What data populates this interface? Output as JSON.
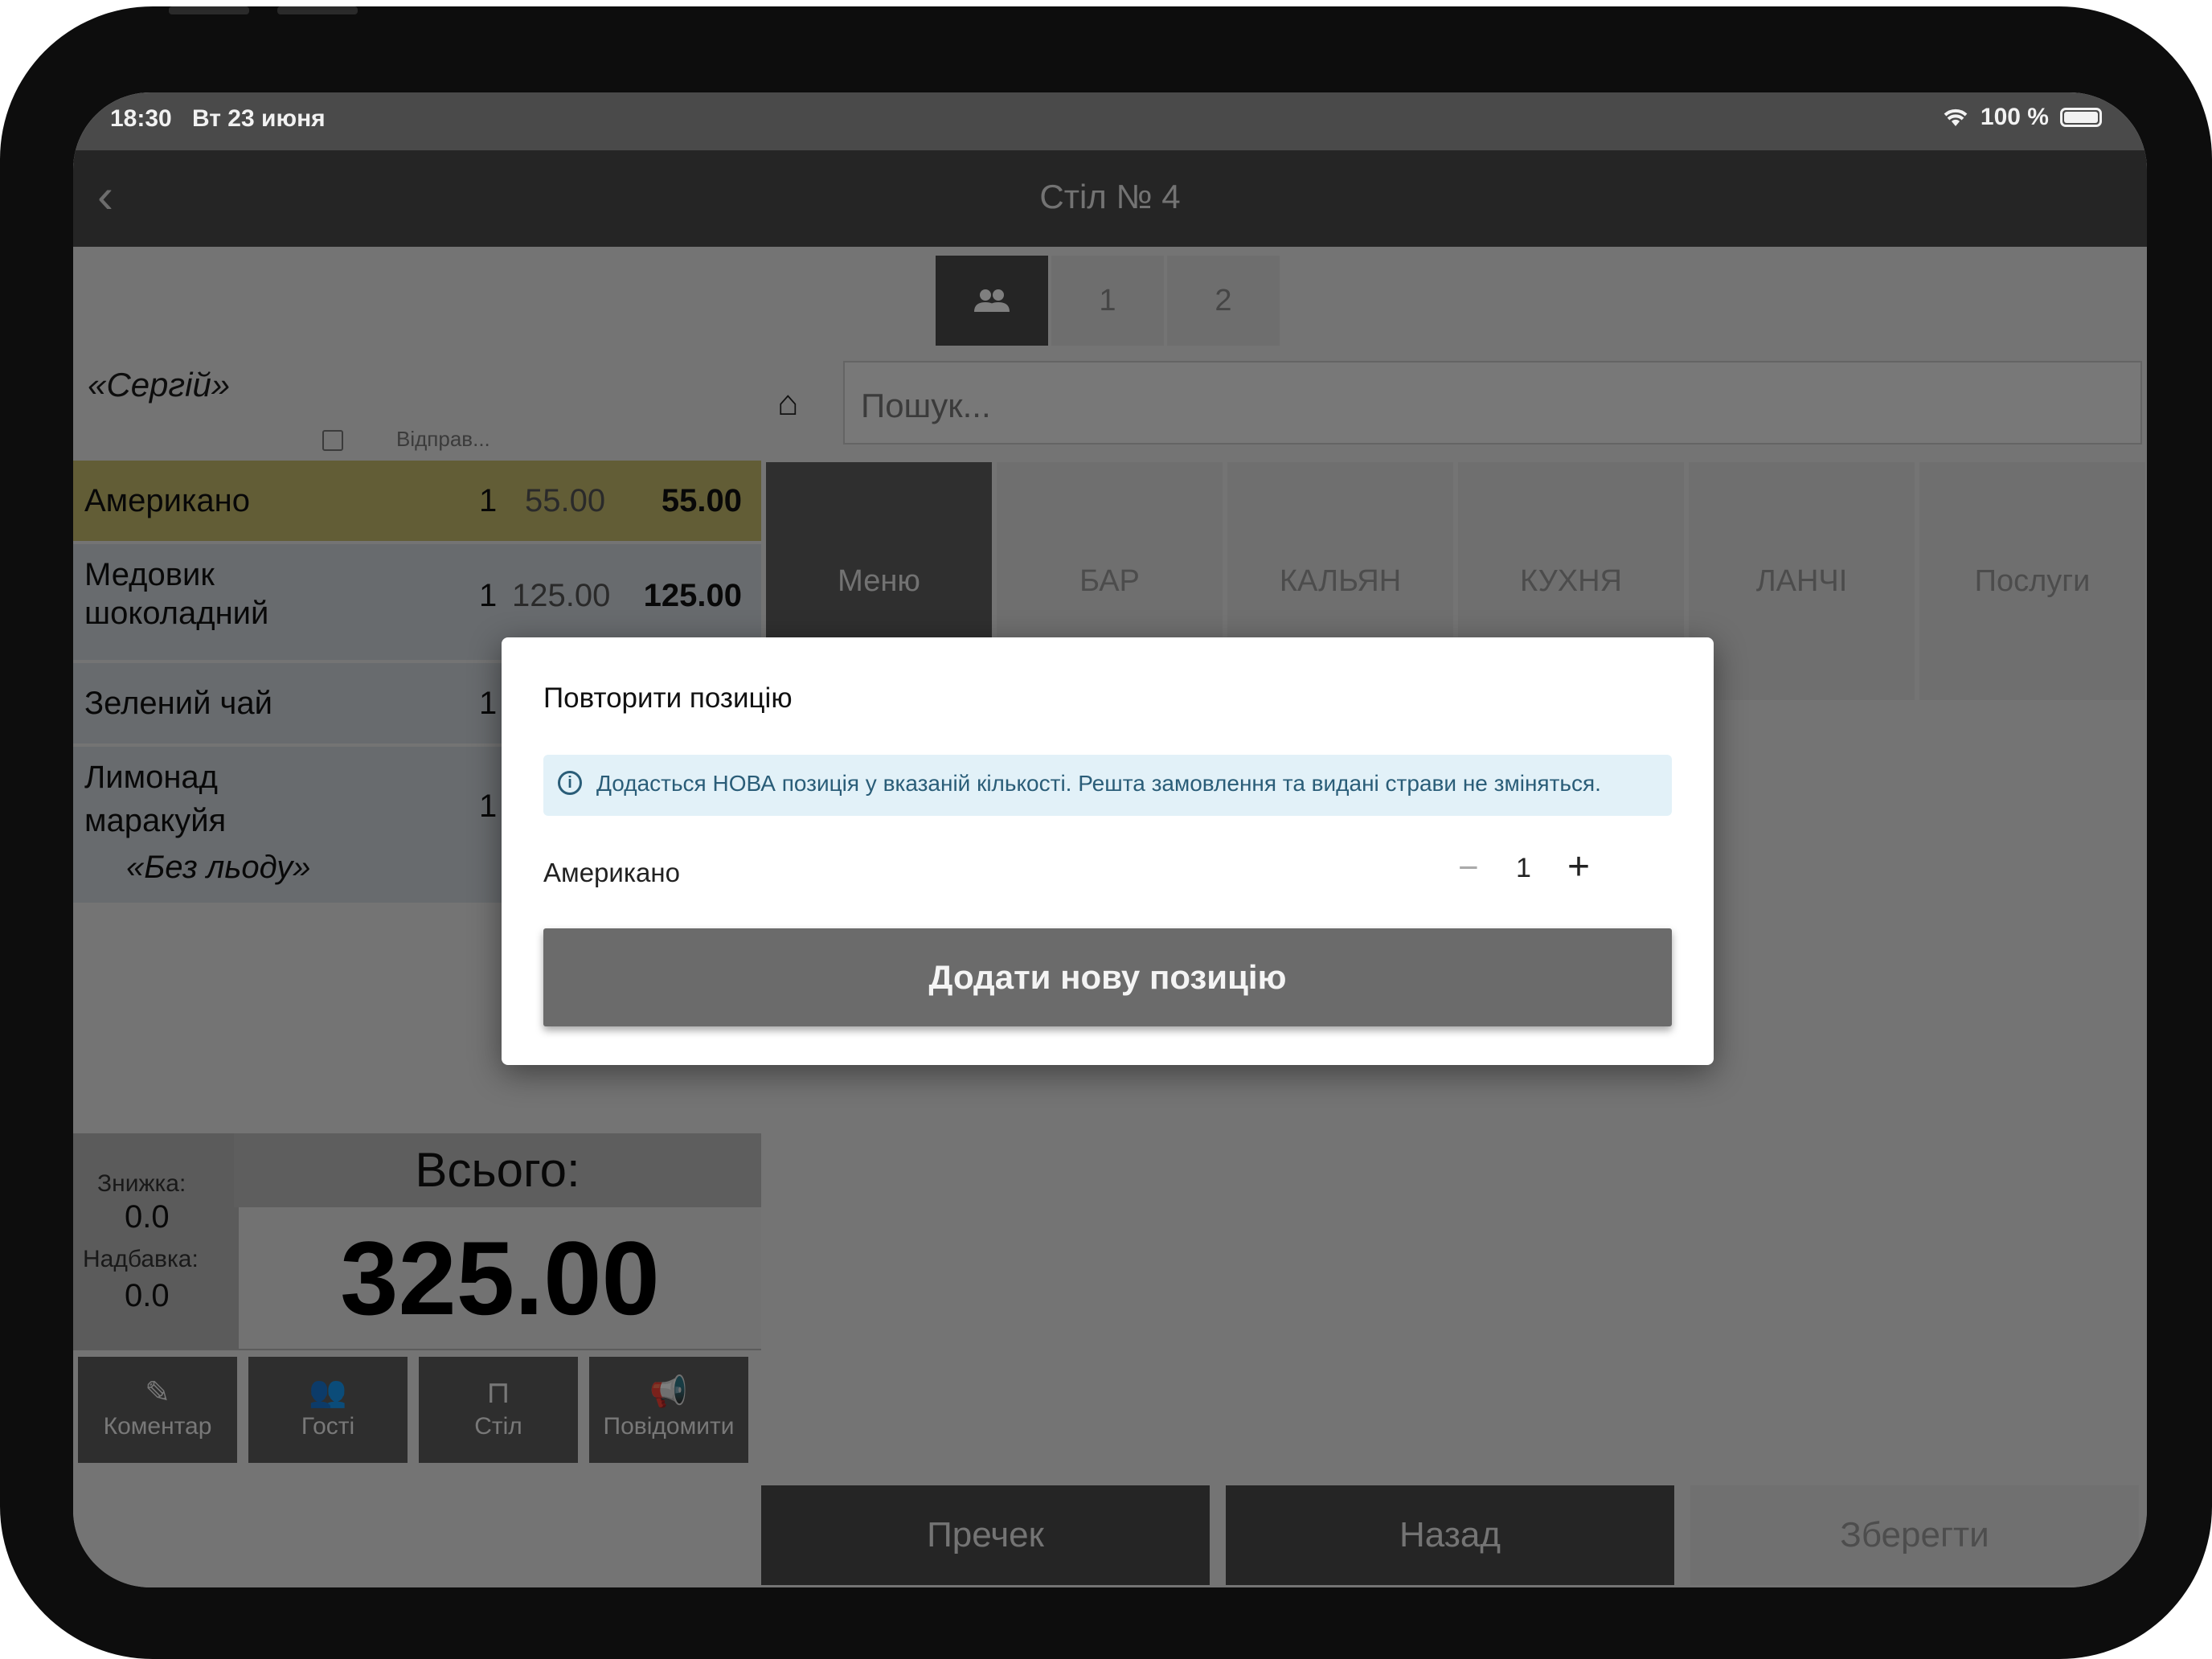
{
  "status_bar": {
    "time": "18:30",
    "date": "Вт 23 июня",
    "battery": "100 %"
  },
  "header": {
    "title": "Стіл № 4",
    "back_icon": "chevron-left-icon"
  },
  "guest_tabs": [
    {
      "icon": "people-icon",
      "label": ""
    },
    {
      "label": "1"
    },
    {
      "label": "2"
    }
  ],
  "order": {
    "guest_name": "«Сергій»",
    "sent_column": "Відправ...",
    "rows": [
      {
        "name": "Американо",
        "qty": "1",
        "price": "55.00",
        "total": "55.00",
        "highlight": "#c4ba6d"
      },
      {
        "name_line1": "Медовик",
        "name_line2": "шоколадний",
        "qty": "1",
        "price": "125.00",
        "total": "125.00"
      },
      {
        "name": "Зелений чай",
        "qty": "1"
      },
      {
        "name_line1": "Лимонад",
        "name_line2": "маракуйя",
        "modifier": "«Без льоду»",
        "qty": "1"
      }
    ]
  },
  "totals": {
    "discount_label": "Знижка:",
    "discount_value": "0.0",
    "surcharge_label": "Надбавка:",
    "surcharge_value": "0.0",
    "total_label": "Всього:",
    "total_value": "325.00"
  },
  "tools": [
    {
      "label": "Коментар",
      "icon": "comment-edit-icon"
    },
    {
      "label": "Гості",
      "icon": "guests-icon"
    },
    {
      "label": "Стіл",
      "icon": "table-icon"
    },
    {
      "label": "Повідомити",
      "icon": "megaphone-icon"
    }
  ],
  "search": {
    "placeholder": "Пошук...",
    "home_icon": "home-icon"
  },
  "categories": [
    "Меню",
    "БАР",
    "КАЛЬЯН",
    "КУХНЯ",
    "ЛАНЧІ",
    "Послуги"
  ],
  "bottom_buttons": {
    "precheck": "Пречек",
    "back": "Назад",
    "save": "Зберегти"
  },
  "dialog": {
    "title": "Повторити позицію",
    "info": "Додасться НОВА позиція у вказаній кількості. Решта замовлення та видані страви не зміняться.",
    "item_name": "Американо",
    "minus": "−",
    "qty": "1",
    "plus": "+",
    "confirm": "Додати нову позицію"
  }
}
